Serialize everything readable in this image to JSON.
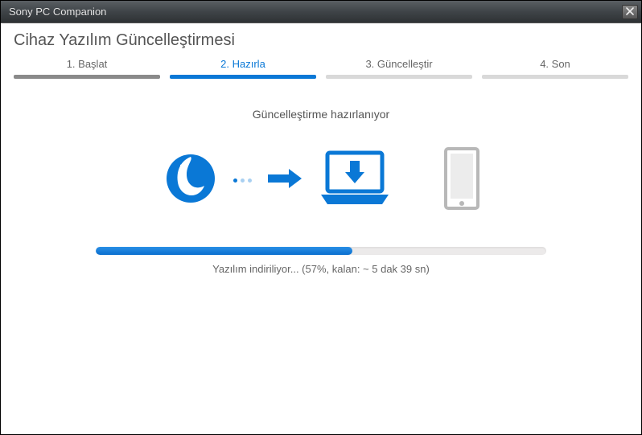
{
  "window": {
    "title": "Sony PC Companion"
  },
  "header": {
    "subtitle": "Cihaz Yazılım Güncelleştirmesi"
  },
  "steps": [
    {
      "label": "1. Başlat",
      "state": "done"
    },
    {
      "label": "2. Hazırla",
      "state": "active"
    },
    {
      "label": "3. Güncelleştir",
      "state": "pending"
    },
    {
      "label": "4. Son",
      "state": "pending"
    }
  ],
  "status": {
    "heading": "Güncelleştirme hazırlanıyor"
  },
  "progress": {
    "percent": 57,
    "text": "Yazılım indiriliyor... (57%, kalan: ~ 5 dak 39 sn)"
  },
  "colors": {
    "accent": "#0a78d6",
    "muted": "#b8b8b8"
  }
}
